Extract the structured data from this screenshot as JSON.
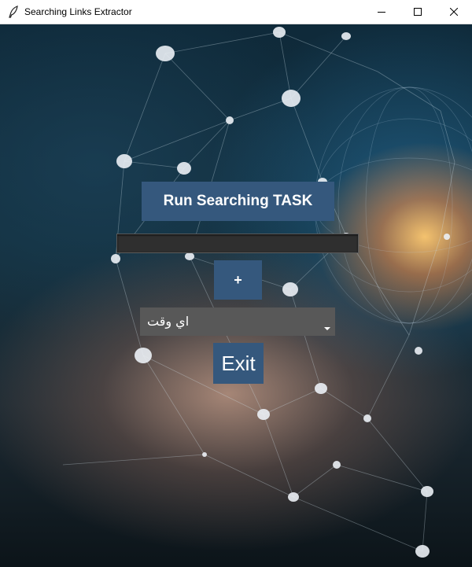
{
  "window": {
    "title": "Searching Links Extractor",
    "icon": "feather-icon",
    "controls": [
      "minimize-icon",
      "maximize-icon",
      "close-icon"
    ]
  },
  "main": {
    "run_button_label": "Run Searching TASK",
    "url_input_value": "",
    "add_button_label": "+",
    "time_select_value": "اي وقت",
    "exit_button_label": "Exit"
  },
  "colors": {
    "button_bg": "#35587d",
    "select_bg": "#585858",
    "entry_bg": "#2f2f2f"
  }
}
